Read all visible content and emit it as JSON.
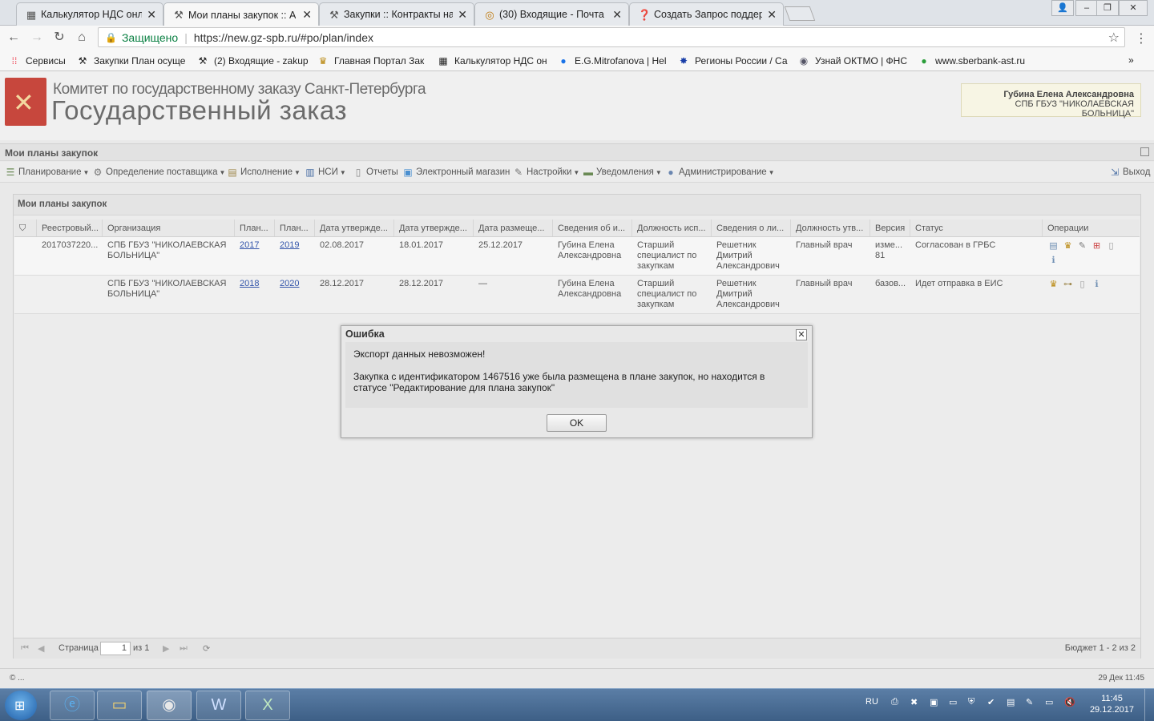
{
  "browser": {
    "tabs": [
      {
        "label": "Калькулятор НДС онлай",
        "icon": "calculator-icon",
        "active": false
      },
      {
        "label": "Мои планы закупок :: А",
        "icon": "tools-icon",
        "active": true
      },
      {
        "label": "Закупки :: Контракты на",
        "icon": "tools-icon",
        "active": false
      },
      {
        "label": "(30) Входящие - Почта",
        "icon": "mail-icon",
        "active": false
      },
      {
        "label": "Создать Запрос поддер",
        "icon": "help-icon",
        "active": false
      }
    ],
    "secure_label": "Защищено",
    "url": "https://new.gz-spb.ru/#po/plan/index",
    "bookmarks": [
      {
        "label": "Сервисы",
        "icon": "apps-icon"
      },
      {
        "label": "Закупки План осуще",
        "icon": "tools-icon"
      },
      {
        "label": "(2) Входящие - zakup",
        "icon": "tools-icon"
      },
      {
        "label": "Главная Портал Зак",
        "icon": "emblem-icon"
      },
      {
        "label": "Калькулятор НДС он",
        "icon": "calculator-icon"
      },
      {
        "label": "E.G.Mitrofanova | Hel",
        "icon": "help-icon"
      },
      {
        "label": "Регионы России / Са",
        "icon": "star-icon"
      },
      {
        "label": "Узнай ОКТМО | ФНС",
        "icon": "seal-icon"
      },
      {
        "label": "www.sberbank-ast.ru",
        "icon": "sber-icon"
      }
    ]
  },
  "header": {
    "org_line1": "Комитет по государственному заказу Санкт-Петербурга",
    "org_line2": "Государственный заказ",
    "user_name": "Губина Елена Александровна",
    "user_org": "СПБ ГБУЗ \"НИКОЛАЕВСКАЯ БОЛЬНИЦА\""
  },
  "panel_title": "Мои планы закупок",
  "toolbar": [
    {
      "label": "Планирование",
      "dropdown": true
    },
    {
      "label": "Определение поставщика",
      "dropdown": true
    },
    {
      "label": "Исполнение",
      "dropdown": true
    },
    {
      "label": "НСИ",
      "dropdown": true
    },
    {
      "label": "Отчеты",
      "dropdown": false
    },
    {
      "label": "Электронный магазин",
      "dropdown": false
    },
    {
      "label": "Настройки",
      "dropdown": true
    },
    {
      "label": "Уведомления",
      "dropdown": true
    },
    {
      "label": "Администрирование",
      "dropdown": true
    }
  ],
  "logout_label": "Выход",
  "grid": {
    "title": "Мои планы закупок",
    "columns": [
      "",
      "Реестровый...",
      "Организация",
      "План...",
      "План...",
      "Дата утвержде...",
      "Дата утвержде...",
      "Дата размеще...",
      "Сведения об и...",
      "Должность исп...",
      "Сведения о ли...",
      "Должность утв...",
      "Версия",
      "Статус",
      "Операции"
    ],
    "rows": [
      [
        "",
        "2017037220...",
        "СПБ ГБУЗ \"НИКОЛАЕВСКАЯ БОЛЬНИЦА\"",
        "2017",
        "2019",
        "02.08.2017",
        "18.01.2017",
        "25.12.2017",
        "Губина Елена Александровна",
        "Старший специалист по закупкам",
        "Решетник Дмитрий Александрович",
        "Главный врач",
        "изме... 81",
        "Согласован в ГРБС",
        ""
      ],
      [
        "",
        "",
        "СПБ ГБУЗ \"НИКОЛАЕВСКАЯ БОЛЬНИЦА\"",
        "2018",
        "2020",
        "28.12.2017",
        "28.12.2017",
        "—",
        "Губина Елена Александровна",
        "Старший специалист по закупкам",
        "Решетник Дмитрий Александрович",
        "Главный врач",
        "базов...",
        "Идет отправка в ЕИС",
        ""
      ]
    ]
  },
  "pager": {
    "page_label": "Страница",
    "page_value": "1",
    "of_label": "из 1",
    "summary": "Бюджет 1 - 2 из 2"
  },
  "footer": {
    "left": "© ...",
    "right": "29 Дек 11:45"
  },
  "modal": {
    "title": "Ошибка",
    "line1": "Экспорт данных невозможен!",
    "line2": "Закупка с идентификатором 1467516 уже была размещена в плане закупок, но находится в статусе \"Редактирование для плана закупок\"",
    "ok_label": "OK"
  },
  "taskbar": {
    "lang": "RU",
    "time": "11:45",
    "date": "29.12.2017"
  }
}
